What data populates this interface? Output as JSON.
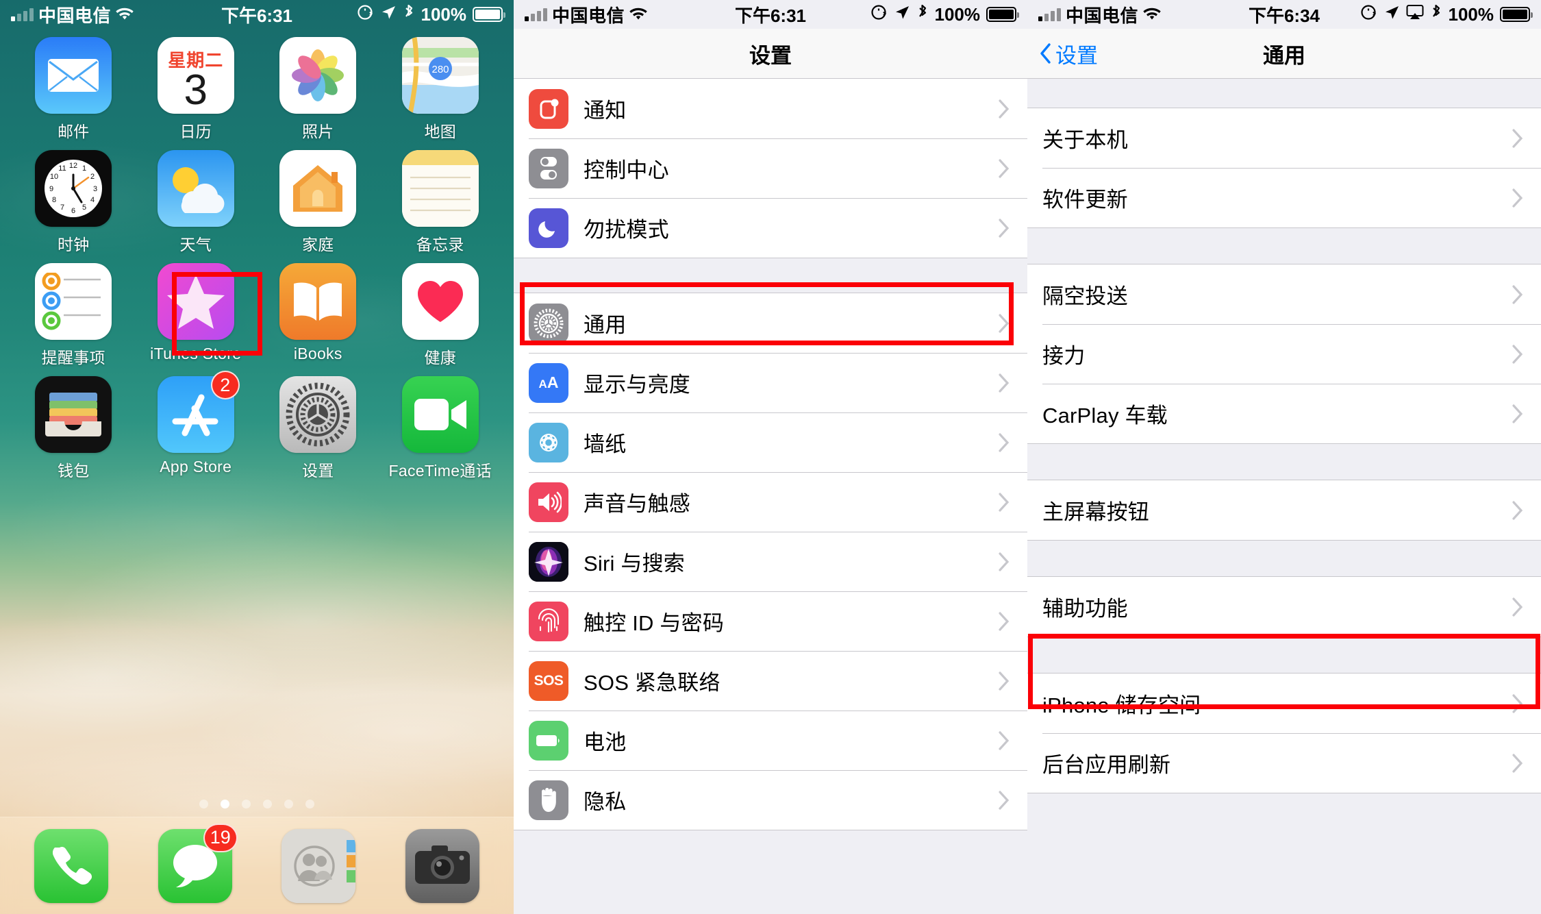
{
  "panels": {
    "home": {
      "status": {
        "carrier": "中国电信",
        "time": "下午6:31",
        "battery": "100%"
      },
      "apps_rows": [
        [
          {
            "label": "邮件",
            "icon": "mail-icon"
          },
          {
            "label": "日历",
            "icon": "calendar-icon",
            "dow": "星期二",
            "day": "3"
          },
          {
            "label": "照片",
            "icon": "photos-icon"
          },
          {
            "label": "地图",
            "icon": "maps-icon"
          }
        ],
        [
          {
            "label": "时钟",
            "icon": "clock-icon"
          },
          {
            "label": "天气",
            "icon": "weather-icon"
          },
          {
            "label": "家庭",
            "icon": "home-icon"
          },
          {
            "label": "备忘录",
            "icon": "notes-icon"
          }
        ],
        [
          {
            "label": "提醒事项",
            "icon": "reminders-icon"
          },
          {
            "label": "iTunes Store",
            "icon": "itunes-store-icon"
          },
          {
            "label": "iBooks",
            "icon": "ibooks-icon"
          },
          {
            "label": "健康",
            "icon": "health-icon"
          }
        ],
        [
          {
            "label": "钱包",
            "icon": "wallet-icon"
          },
          {
            "label": "App Store",
            "icon": "app-store-icon",
            "badge": "2"
          },
          {
            "label": "设置",
            "icon": "settings-icon",
            "highlighted": true
          },
          {
            "label": "FaceTime通话",
            "icon": "facetime-icon"
          }
        ]
      ],
      "page_dots": {
        "count": 6,
        "active_index": 1
      },
      "dock": [
        {
          "label": "电话",
          "icon": "phone-icon"
        },
        {
          "label": "信息",
          "icon": "messages-icon",
          "badge": "19"
        },
        {
          "label": "通讯录",
          "icon": "contacts-icon"
        },
        {
          "label": "相机",
          "icon": "camera-icon"
        }
      ]
    },
    "settings": {
      "status": {
        "carrier": "中国电信",
        "time": "下午6:31",
        "battery": "100%"
      },
      "title": "设置",
      "groups": [
        {
          "rows": [
            {
              "label": "通知",
              "icon": "notifications-icon"
            },
            {
              "label": "控制中心",
              "icon": "control-center-icon"
            },
            {
              "label": "勿扰模式",
              "icon": "do-not-disturb-icon"
            }
          ]
        },
        {
          "rows": [
            {
              "label": "通用",
              "icon": "general-gear-icon",
              "highlighted": true
            },
            {
              "label": "显示与亮度",
              "icon": "display-brightness-icon"
            },
            {
              "label": "墙纸",
              "icon": "wallpaper-icon"
            },
            {
              "label": "声音与触感",
              "icon": "sounds-haptics-icon"
            },
            {
              "label": "Siri 与搜索",
              "icon": "siri-search-icon"
            },
            {
              "label": "触控 ID 与密码",
              "icon": "touch-id-icon"
            },
            {
              "label": "SOS 紧急联络",
              "icon": "emergency-sos-icon"
            },
            {
              "label": "电池",
              "icon": "battery-icon"
            },
            {
              "label": "隐私",
              "icon": "privacy-hand-icon"
            }
          ]
        }
      ]
    },
    "general": {
      "status": {
        "carrier": "中国电信",
        "time": "下午6:34",
        "battery": "100%"
      },
      "back_label": "设置",
      "title": "通用",
      "groups": [
        {
          "rows": [
            {
              "label": "关于本机"
            },
            {
              "label": "软件更新"
            }
          ]
        },
        {
          "rows": [
            {
              "label": "隔空投送"
            },
            {
              "label": "接力"
            },
            {
              "label": "CarPlay 车载"
            }
          ]
        },
        {
          "rows": [
            {
              "label": "主屏幕按钮"
            }
          ]
        },
        {
          "rows": [
            {
              "label": "辅助功能",
              "highlighted": true
            }
          ]
        },
        {
          "rows": [
            {
              "label": "iPhone 储存空间"
            },
            {
              "label": "后台应用刷新"
            }
          ]
        }
      ]
    }
  },
  "colors": {
    "highlight": "#fb0007",
    "accent": "#007aff",
    "group_bg": "#efeff4",
    "separator": "#c8c7cc"
  }
}
